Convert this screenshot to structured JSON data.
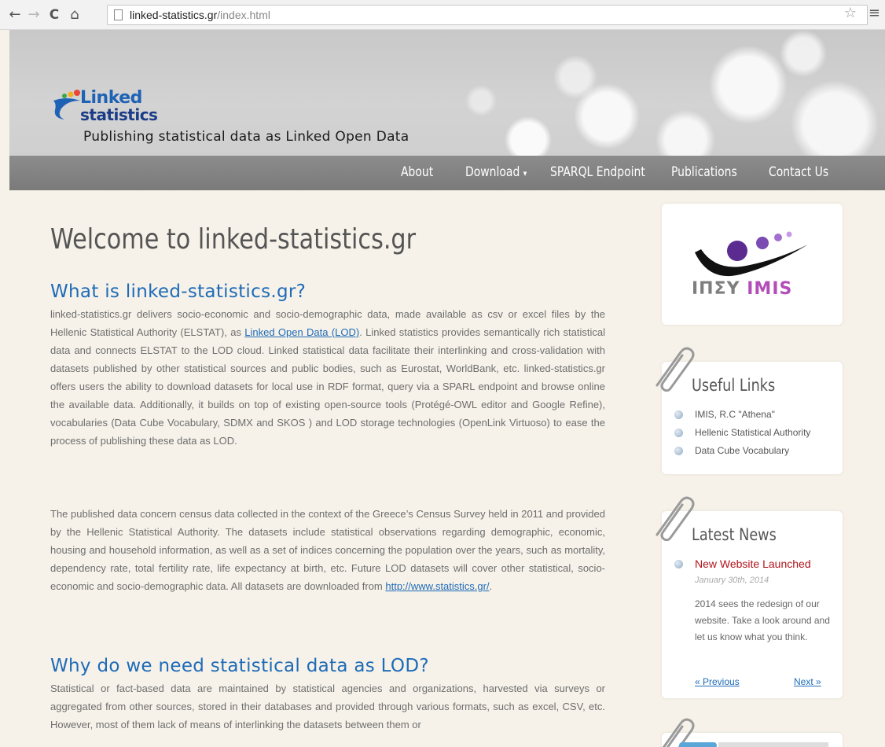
{
  "browser": {
    "back_glyph": "←",
    "forward_glyph": "→",
    "reload_glyph": "C",
    "home_glyph": "⌂",
    "url_host": "linked-statistics.gr",
    "url_path": "/index.html",
    "star_glyph": "☆",
    "menu_glyph": "≡"
  },
  "header": {
    "logo_line1": "Linked",
    "logo_line2": "statistics",
    "tagline": "Publishing statistical data as Linked Open Data"
  },
  "nav": {
    "about": "About",
    "download": "Download",
    "download_caret": "▾",
    "sparql": "SPARQL Endpoint",
    "publications": "Publications",
    "contact": "Contact Us"
  },
  "main": {
    "welcome": "Welcome to linked-statistics.gr",
    "h_what": "What is linked-statistics.gr?",
    "p1_a": "linked-statistics.gr delivers socio-economic and socio-demographic data, made available as csv or excel files by the Hellenic Statistical Authority (ELSTAT), as ",
    "p1_link": "Linked Open Data (LOD)",
    "p1_b": ". Linked statistics provides semantically rich statistical data and connects ELSTAT to the LOD cloud. Linked statistical data facilitate their interlinking and cross-validation with datasets published by other statistical sources and public bodies, such as Eurostat, WorldBank, etc. linked-statistics.gr offers users the ability to download datasets for local use in RDF format, query via a SPARL endpoint and browse online the available data. Additionally, it builds on top of existing open-source tools (Protégé-OWL editor and Google Refine), vocabularies (Data Cube Vocabulary, SDMX and SKOS ) and LOD storage technologies (OpenLink Virtuoso) to ease the process of publishing these data as LOD.",
    "p2_a": "The published data concern census data collected in the context of the Greece’s Census Survey held in 2011 and provided by the Hellenic Statistical Authority. The datasets include statistical observations regarding demographic, economic, housing and household information, as well as a set of indices concerning the population over the years, such as mortality, dependency rate, total fertility rate, life expectancy at birth, etc. Future LOD datasets will cover other statistical, socio-economic and socio-demographic data. All datasets are downloaded from ",
    "p2_link": "http://www.statistics.gr/",
    "p2_b": ".",
    "h_why": "Why do we need statistical data as LOD?",
    "p3": "Statistical or fact-based data are maintained by statistical agencies and organizations, harvested via surveys or aggregated from other sources, stored in their databases and provided through various formats, such as excel, CSV, etc. However, most of them lack of means of interlinking the datasets between them or"
  },
  "sidebar": {
    "imis_gr": "ΙΠΣΥ",
    "imis_en": "IMIS",
    "useful_title": "Useful Links",
    "useful_links": [
      "IMIS, R.C \"Athena\"",
      "Hellenic Statistical Authority",
      "Data Cube Vocabulary"
    ],
    "news_title": "Latest News",
    "news_item_title": "New Website Launched",
    "news_item_date": "January 30th, 2014",
    "news_item_body": "2014 sees the redesign of our website. Take a look around and let us know what you think.",
    "prev": "« Previous",
    "next": "Next »"
  },
  "colors": {
    "link": "#1e6bb8",
    "heading": "#1e6bb8",
    "news_title": "#b0141c",
    "navbar": "#828282",
    "page_bg": "#f6f2e9"
  }
}
